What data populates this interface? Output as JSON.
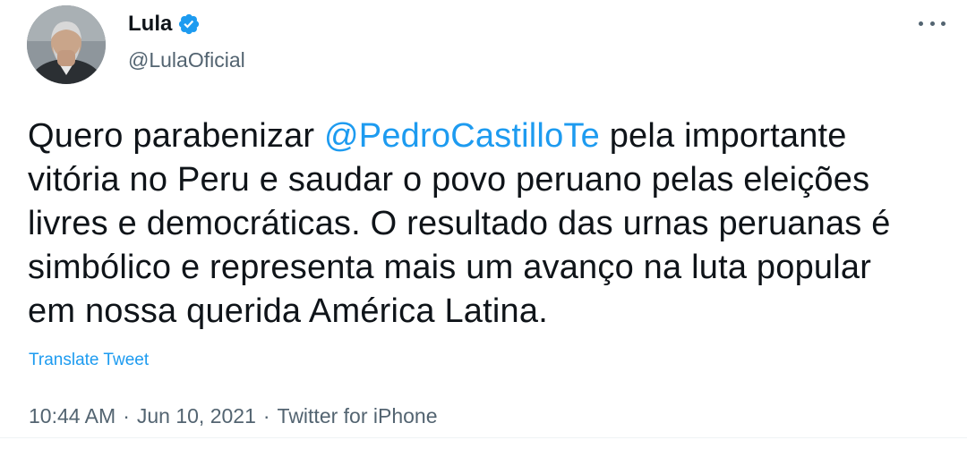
{
  "user": {
    "display_name": "Lula",
    "handle": "@LulaOficial",
    "verified": true
  },
  "tweet": {
    "line1_pre": "Quero parabenizar ",
    "mention": "@PedroCastilloTe",
    "line1_post": " pela importante",
    "line2": "vitória no Peru e saudar o povo peruano pelas eleições",
    "line3": "livres e democráticas. O resultado das urnas peruanas é",
    "line4": "simbólico e representa mais um avanço na luta popular",
    "line5": "em nossa querida América Latina."
  },
  "translate_label": "Translate Tweet",
  "meta": {
    "time": "10:44 AM",
    "separator": "·",
    "date": "Jun 10, 2021",
    "source": "Twitter for iPhone"
  },
  "colors": {
    "accent": "#1d9bf0",
    "secondary_text": "#536471",
    "primary_text": "#0f1419"
  },
  "icons": {
    "verified": "verified-badge-icon",
    "more": "more-options-icon"
  }
}
